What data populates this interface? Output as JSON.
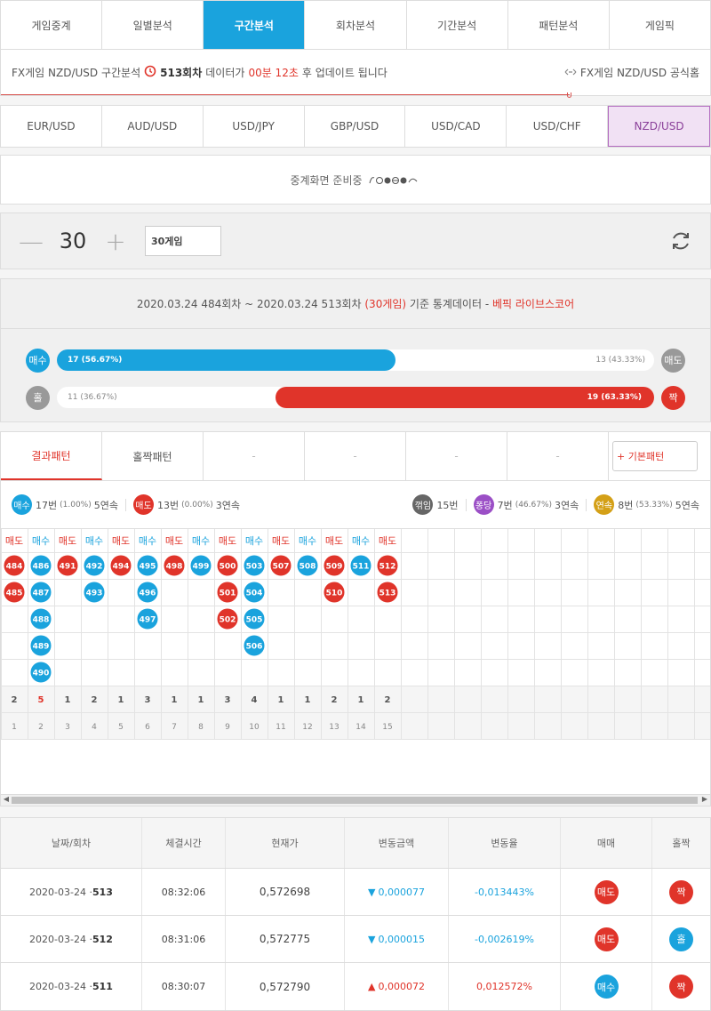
{
  "tabs": [
    "게임중계",
    "일별분석",
    "구간분석",
    "회차분석",
    "기간분석",
    "패턴분석",
    "게임픽"
  ],
  "info": {
    "prefix": "FX게임 NZD/USD 구간분석",
    "round": "513회차",
    "data_label": "데이터가",
    "time": "00분 12초",
    "suffix": "후 업데이트 됩니다",
    "official": "FX게임 NZD/USD 공식홈"
  },
  "pairs": [
    "EUR/USD",
    "AUD/USD",
    "USD/JPY",
    "GBP/USD",
    "USD/CAD",
    "USD/CHF",
    "NZD/USD"
  ],
  "live": {
    "text": "중계화면 준비중"
  },
  "control": {
    "count": "30",
    "select": "30게임"
  },
  "stats": {
    "range": "2020.03.24 484회차 ~ 2020.03.24 513회차",
    "games": "(30게임)",
    "base": "기준 통계데이터 -",
    "brand": "베픽 라이브스코어",
    "buy": {
      "label": "매수",
      "fill": "17 (56.67%)",
      "pct": 56.67
    },
    "sell": {
      "label": "매도",
      "rest": "13 (43.33%)"
    },
    "odd": {
      "label": "홀",
      "rest": "11 (36.67%)"
    },
    "even": {
      "label": "짝",
      "fill": "19 (63.33%)",
      "pct": 63.33
    }
  },
  "pattern_tabs": {
    "t1": "결과패턴",
    "t2": "홀짝패턴",
    "dash": "-",
    "basic": "+ 기본패턴"
  },
  "summary": {
    "buy": {
      "badge": "매수",
      "count": "17번",
      "pct": "(1.00%)",
      "streak": "5연속"
    },
    "sell": {
      "badge": "매도",
      "count": "13번",
      "pct": "(0.00%)",
      "streak": "3연속"
    },
    "bounce": {
      "badge": "꺾임",
      "count": "15번"
    },
    "pong": {
      "badge": "퐁당",
      "count": "7번",
      "pct": "(46.67%)",
      "streak": "3연속"
    },
    "cont": {
      "badge": "연속",
      "count": "8번",
      "pct": "(53.33%)",
      "streak": "5연속"
    }
  },
  "columns": [
    {
      "head": "매도",
      "type": "sell",
      "balls": [
        "484",
        "485"
      ],
      "total": "2",
      "idx": "1"
    },
    {
      "head": "매수",
      "type": "buy",
      "balls": [
        "486",
        "487",
        "488",
        "489",
        "490"
      ],
      "total": "5",
      "idx": "2"
    },
    {
      "head": "매도",
      "type": "sell",
      "balls": [
        "491"
      ],
      "total": "1",
      "idx": "3"
    },
    {
      "head": "매수",
      "type": "buy",
      "balls": [
        "492",
        "493"
      ],
      "total": "2",
      "idx": "4"
    },
    {
      "head": "매도",
      "type": "sell",
      "balls": [
        "494"
      ],
      "total": "1",
      "idx": "5"
    },
    {
      "head": "매수",
      "type": "buy",
      "balls": [
        "495",
        "496",
        "497"
      ],
      "total": "3",
      "idx": "6"
    },
    {
      "head": "매도",
      "type": "sell",
      "balls": [
        "498"
      ],
      "total": "1",
      "idx": "7"
    },
    {
      "head": "매수",
      "type": "buy",
      "balls": [
        "499"
      ],
      "total": "1",
      "idx": "8"
    },
    {
      "head": "매도",
      "type": "sell",
      "balls": [
        "500",
        "501",
        "502"
      ],
      "total": "3",
      "idx": "9"
    },
    {
      "head": "매수",
      "type": "buy",
      "balls": [
        "503",
        "504",
        "505",
        "506"
      ],
      "total": "4",
      "idx": "10"
    },
    {
      "head": "매도",
      "type": "sell",
      "balls": [
        "507"
      ],
      "total": "1",
      "idx": "11"
    },
    {
      "head": "매수",
      "type": "buy",
      "balls": [
        "508"
      ],
      "total": "1",
      "idx": "12"
    },
    {
      "head": "매도",
      "type": "sell",
      "balls": [
        "509",
        "510"
      ],
      "total": "2",
      "idx": "13"
    },
    {
      "head": "매수",
      "type": "buy",
      "balls": [
        "511"
      ],
      "total": "1",
      "idx": "14"
    },
    {
      "head": "매도",
      "type": "sell",
      "balls": [
        "512",
        "513"
      ],
      "total": "2",
      "idx": "15"
    }
  ],
  "table": {
    "headers": [
      "날짜/회차",
      "체결시간",
      "현재가",
      "변동금액",
      "변동율",
      "매매",
      "홀짝"
    ],
    "rows": [
      {
        "date": "2020-03-24 ·",
        "round": "513",
        "time": "08:32:06",
        "price": "0,572698",
        "dir": "down",
        "arrow": "▼",
        "amt": "0,000077",
        "rate": "-0,013443%",
        "trade": "매도",
        "trade_type": "sell",
        "oe": "짝",
        "oe_type": "even"
      },
      {
        "date": "2020-03-24 ·",
        "round": "512",
        "time": "08:31:06",
        "price": "0,572775",
        "dir": "down",
        "arrow": "▼",
        "amt": "0,000015",
        "rate": "-0,002619%",
        "trade": "매도",
        "trade_type": "sell",
        "oe": "홀",
        "oe_type": "odd"
      },
      {
        "date": "2020-03-24 ·",
        "round": "511",
        "time": "08:30:07",
        "price": "0,572790",
        "dir": "up",
        "arrow": "▲",
        "amt": "0,000072",
        "rate": "0,012572%",
        "trade": "매수",
        "trade_type": "buy",
        "oe": "짝",
        "oe_type": "even"
      }
    ]
  },
  "colors": {
    "blue": "#1aa3dd",
    "red": "#e0342a",
    "purple": "#9b4fc6",
    "gold": "#d4a017",
    "dark": "#666666"
  }
}
